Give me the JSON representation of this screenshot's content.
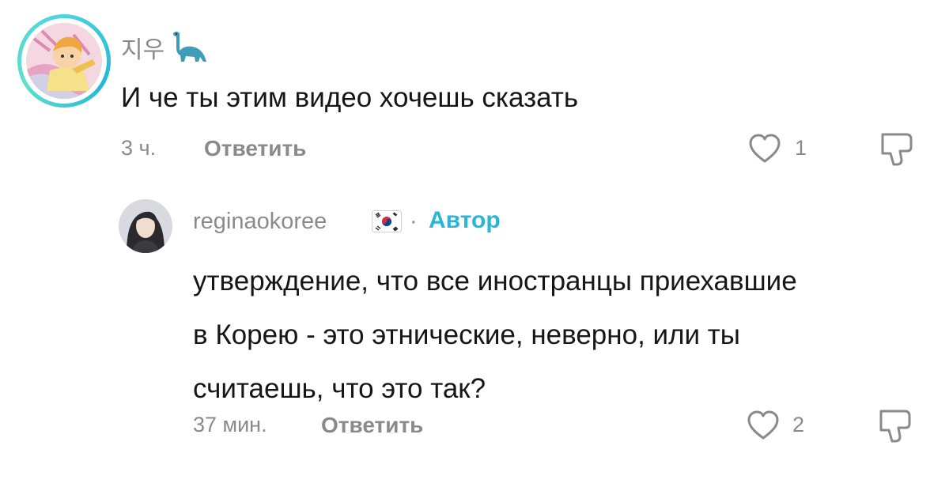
{
  "comments": [
    {
      "username": "지우",
      "username_emoji": "dinosaur-icon",
      "text": "И че ты этим видео хочешь сказать",
      "time": "3 ч.",
      "reply_label": "Ответить",
      "likes": "1"
    },
    {
      "username": "reginaokoree",
      "username_emoji": "south-korea-flag-icon",
      "separator": "·",
      "author_badge": "Автор",
      "text_lines": [
        "утверждение, что все иностранцы приехавшие",
        "в Корею - это этнические, неверно, или ты",
        "считаешь, что это так?"
      ],
      "time": "37 мин.",
      "reply_label": "Ответить",
      "likes": "2"
    }
  ],
  "colors": {
    "secondary_text": "#8a8a8a",
    "primary_text": "#161616",
    "author_accent": "#2ab6d4",
    "avatar_ring": "#4fd3e0"
  }
}
